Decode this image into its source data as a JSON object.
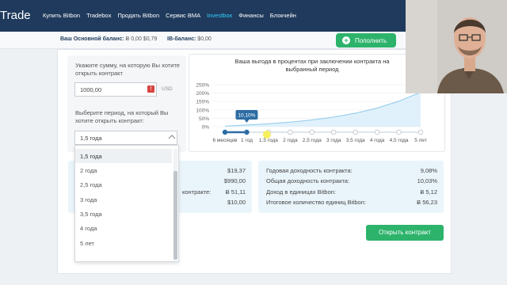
{
  "header": {
    "logo": "Trade",
    "nav": [
      "Купить Bitbon",
      "Tradebox",
      "Продать Bitbon",
      "Сервис BMA",
      "Investbox",
      "Финансы",
      "Блокчейн"
    ],
    "active_nav": "Investbox"
  },
  "balance": {
    "main_label": "Ваш Основной баланс:",
    "main_value_b": "Ƀ 0,00",
    "main_value_usd": "$0,79",
    "ib_label": "IB-баланс:",
    "ib_value": "$0,00",
    "topup_label": "Пополнить"
  },
  "form": {
    "amount_label": "Укажите сумму, на которую Вы хотите открыть контракт",
    "amount_value": "1000,00",
    "currency": "USD",
    "period_label": "Выберите период, на который Вы хотите открыть контракт:",
    "selected_period": "1,5 года",
    "options": [
      "1,5 года",
      "2 года",
      "2,5 года",
      "3 года",
      "3,5 года",
      "4 года",
      "5 лет"
    ]
  },
  "chart_data": {
    "type": "area",
    "title": "Ваша выгода в процентах при заключении контракта на выбранный период",
    "categories": [
      "6 месяцев",
      "1 год",
      "1,5 года",
      "2 года",
      "2,5 года",
      "3 года",
      "3,5 года",
      "4 года",
      "4,5 года",
      "5 лет"
    ],
    "yticks": [
      "250%",
      "200%",
      "150%",
      "100%",
      "50%",
      "0%"
    ],
    "ylim": [
      0,
      250
    ],
    "tooltip": "10,10%",
    "series": [
      {
        "values": [
          3,
          10.1,
          17,
          27,
          40,
          57,
          80,
          111,
          152,
          205
        ]
      }
    ],
    "selected_index": 1,
    "grid": true,
    "colors": {
      "area": "#dbeefa",
      "line": "#8ec9ec",
      "selected": "#2e6da4"
    }
  },
  "stats_left": [
    {
      "value": "$19,37"
    },
    {
      "value": "$990,00"
    },
    {
      "label": "контракте:",
      "value": "Ƀ 51,11"
    },
    {
      "value": "$10,00"
    }
  ],
  "stats_right": [
    {
      "label": "Годовая доходность контракта:",
      "value": "9,08%"
    },
    {
      "label": "Общая доходность контракта:",
      "value": "10,03%"
    },
    {
      "label": "Доход в единицах Bitbon:",
      "value": "Ƀ 5,12"
    },
    {
      "label": "Итоговое количество единиц Bitbon:",
      "value": "Ƀ 56,23"
    }
  ],
  "open_button": "Открыть контракт",
  "colors": {
    "header": "#1f3a5c",
    "accent": "#2db36b",
    "active_nav": "#35d3ff"
  }
}
